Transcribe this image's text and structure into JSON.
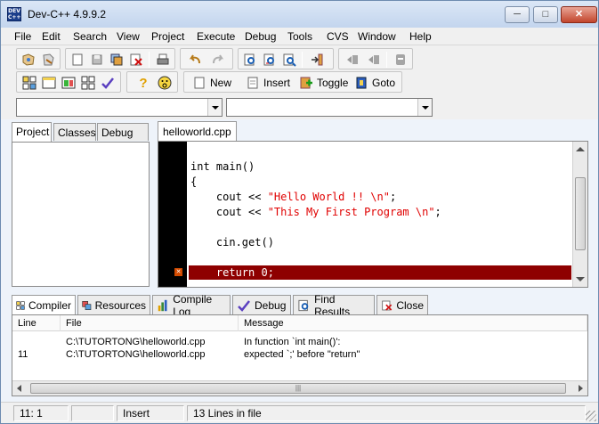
{
  "window": {
    "title": "Dev-C++ 4.9.9.2",
    "icon_label": "DEV C++"
  },
  "menu": [
    "File",
    "Edit",
    "Search",
    "View",
    "Project",
    "Execute",
    "Debug",
    "Tools",
    "CVS",
    "Window",
    "Help"
  ],
  "toolbar": {
    "new_label": "New",
    "insert_label": "Insert",
    "toggle_label": "Toggle",
    "goto_label": "Goto"
  },
  "combos": {
    "class_value": "",
    "member_value": ""
  },
  "left_tabs": [
    "Project",
    "Classes",
    "Debug"
  ],
  "editor": {
    "file_tab": "helloworld.cpp",
    "lines": [
      {
        "text": "int main()"
      },
      {
        "text": "{"
      },
      {
        "pre": "    cout << ",
        "str": "\"Hello World !! \\n\"",
        "post": ";"
      },
      {
        "pre": "    cout << ",
        "str": "\"This My First Program \\n\"",
        "post": ";"
      },
      {
        "text": ""
      },
      {
        "text": "    cin.get()"
      },
      {
        "text": ""
      },
      {
        "text": "    return 0;",
        "error": true
      }
    ]
  },
  "bottom_tabs": [
    "Compiler",
    "Resources",
    "Compile Log",
    "Debug",
    "Find Results",
    "Close"
  ],
  "messages": {
    "columns": [
      "Line",
      "File",
      "Message"
    ],
    "rows": [
      {
        "line": "",
        "file": "C:\\TUTORTONG\\helloworld.cpp",
        "message": "In function `int main()':"
      },
      {
        "line": "11",
        "file": "C:\\TUTORTONG\\helloworld.cpp",
        "message": "expected `;' before \"return\""
      }
    ]
  },
  "status": {
    "position": "11: 1",
    "blank": "",
    "mode": "Insert",
    "info": "13 Lines in file"
  }
}
